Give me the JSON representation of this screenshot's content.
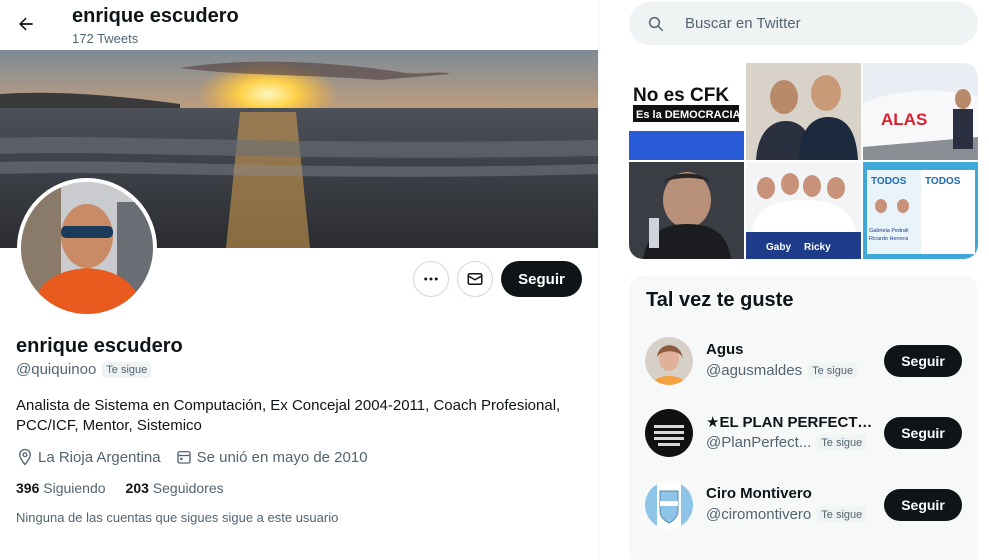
{
  "header": {
    "name": "enrique escudero",
    "tweet_count": "172 Tweets"
  },
  "profile": {
    "name": "enrique escudero",
    "handle": "@quiquinoo",
    "follows_you": "Te sigue",
    "bio": "Analista de Sistema en Computación, Ex Concejal  2004-2011, Coach Profesional, PCC/ICF, Mentor, Sistemico",
    "location": "La Rioja Argentina",
    "joined": "Se unió en mayo de 2010",
    "following_count": "396",
    "following_label": "Siguiendo",
    "followers_count": "203",
    "followers_label": "Seguidores",
    "followers_note": "Ninguna de las cuentas que sigues sigue a este usuario",
    "follow_label": "Seguir"
  },
  "search": {
    "placeholder": "Buscar en Twitter"
  },
  "media": {
    "tile1_line1": "No es CFK",
    "tile1_line2": "Es la DEMOCRACIA",
    "tile3_logo": "ALAS",
    "tile5_text1": "Gaby",
    "tile5_text2": "Ricky",
    "tile6_logo": "TODOS",
    "tile6_name1": "Gabriela Pedrali",
    "tile6_name2": "Ricardo Herrera"
  },
  "suggestions": {
    "title": "Tal vez te guste",
    "follow_label": "Seguir",
    "items": [
      {
        "name": "Agus",
        "handle": "@agusmaldes",
        "badge": "Te sigue"
      },
      {
        "name": "★EL PLAN PERFECTO...",
        "handle": "@PlanPerfect...",
        "badge": "Te sigue"
      },
      {
        "name": "Ciro Montivero",
        "handle": "@ciromontivero",
        "badge": "Te sigue"
      }
    ]
  },
  "colors": {
    "accent": "#0f1419",
    "muted": "#536471",
    "border": "#cfd9de",
    "panel": "#f7f9f9"
  }
}
